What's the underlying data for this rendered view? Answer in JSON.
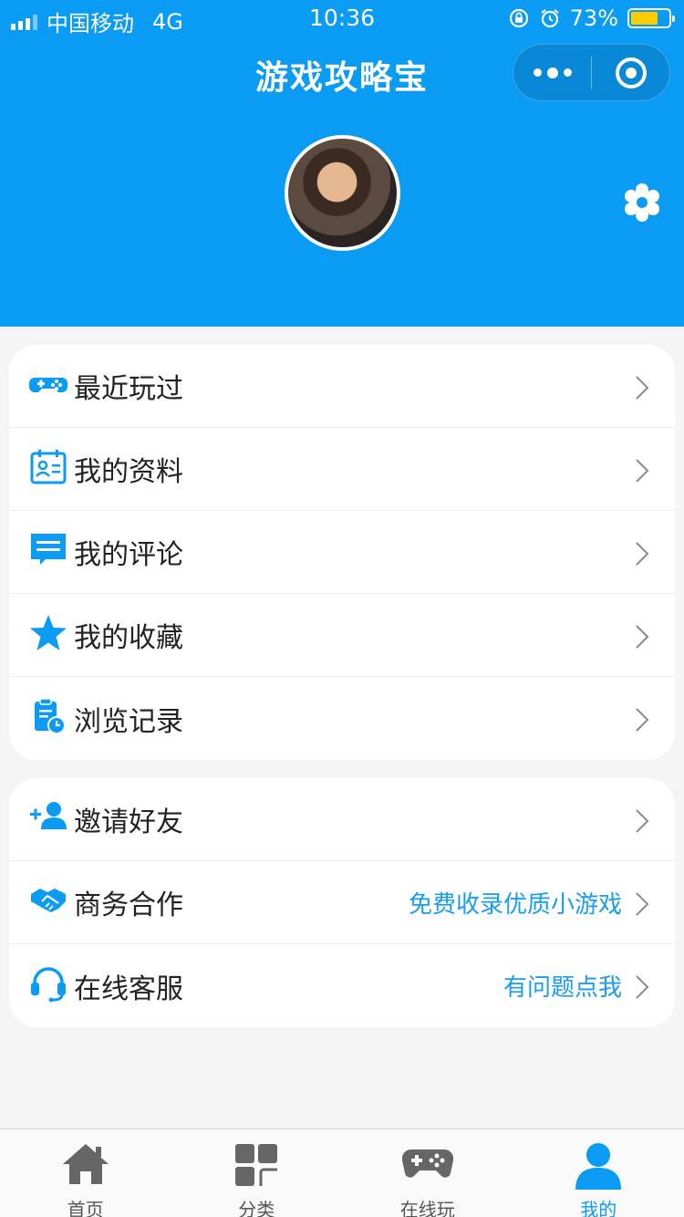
{
  "status_bar": {
    "carrier": "中国移动",
    "network": "4G",
    "time": "10:36",
    "battery": "73%",
    "battery_level": 0.73
  },
  "header": {
    "title": "游戏攻略宝",
    "background_color": "#0a9bf5"
  },
  "menu_group_1": [
    {
      "label": "最近玩过",
      "icon": "gamepad-icon"
    },
    {
      "label": "我的资料",
      "icon": "profile-card-icon"
    },
    {
      "label": "我的评论",
      "icon": "comment-icon"
    },
    {
      "label": "我的收藏",
      "icon": "star-icon"
    },
    {
      "label": "浏览记录",
      "icon": "history-icon"
    }
  ],
  "menu_group_2": [
    {
      "label": "邀请好友",
      "hint": "",
      "icon": "add-friend-icon"
    },
    {
      "label": "商务合作",
      "hint": "免费收录优质小游戏",
      "icon": "handshake-icon"
    },
    {
      "label": "在线客服",
      "hint": "有问题点我",
      "icon": "headset-icon"
    }
  ],
  "tabbar": [
    {
      "label": "首页",
      "icon": "home-icon",
      "active": false
    },
    {
      "label": "分类",
      "icon": "category-icon",
      "active": false
    },
    {
      "label": "在线玩",
      "icon": "gamepad-icon",
      "active": false
    },
    {
      "label": "我的",
      "icon": "user-icon",
      "active": true
    }
  ],
  "colors": {
    "accent": "#0a9bf5",
    "hint_text": "#1a9cf0",
    "inactive_tab": "#666666"
  }
}
